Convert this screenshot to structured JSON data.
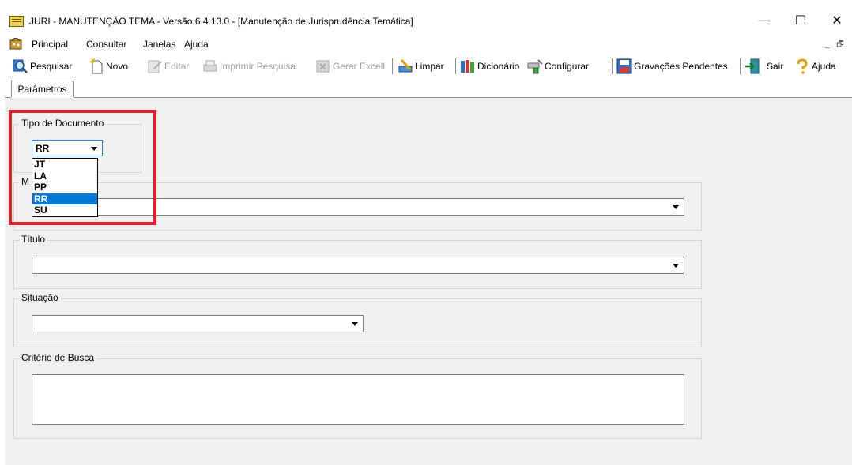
{
  "window": {
    "title": "JURI - MANUTENÇÃO TEMA - Versão 6.4.13.0 - [Manutenção de Jurisprudência Temática]",
    "minimize_glyph": "—",
    "maximize_glyph": "☐",
    "close_glyph": "✕"
  },
  "menu": {
    "items": [
      "Principal",
      "Consultar",
      "Janelas",
      "Ajuda"
    ],
    "mdi_min": "_",
    "mdi_restore": "🗗"
  },
  "toolbar": {
    "buttons": [
      {
        "label": "Pesquisar",
        "icon": "search-icon",
        "enabled": true
      },
      {
        "label": "Novo",
        "icon": "new-document-icon",
        "enabled": true
      },
      {
        "label": "Editar",
        "icon": "edit-icon",
        "enabled": false
      },
      {
        "label": "Imprimir Pesquisa",
        "icon": "printer-icon",
        "enabled": false
      },
      {
        "label": "Gerar Excell",
        "icon": "excel-icon",
        "enabled": false
      },
      {
        "label": "Limpar",
        "icon": "clear-icon",
        "enabled": true
      },
      {
        "label": "Dicionário",
        "icon": "books-icon",
        "enabled": true
      },
      {
        "label": "Configurar",
        "icon": "configure-icon",
        "enabled": true
      },
      {
        "label": "Gravações Pendentes",
        "icon": "save-pending-icon",
        "enabled": true
      },
      {
        "label": "Sair",
        "icon": "exit-icon",
        "enabled": true
      },
      {
        "label": "Ajuda",
        "icon": "help-icon",
        "enabled": true
      }
    ]
  },
  "tabs": [
    {
      "label": "Parâmetros",
      "active": true
    }
  ],
  "form": {
    "tipo_documento": {
      "label": "Tipo de Documento",
      "value": "RR",
      "options": [
        "JT",
        "LA",
        "PP",
        "RR",
        "SU"
      ],
      "selected_option": "RR"
    },
    "group2": {
      "label": "M",
      "value": ""
    },
    "titulo": {
      "label": "Título",
      "value": ""
    },
    "situacao": {
      "label": "Situação",
      "value": ""
    },
    "criterio": {
      "label": "Critério de Busca",
      "value": ""
    }
  },
  "colors": {
    "highlight": "#e0202b",
    "selection": "#0078d7",
    "panel": "#f0f0f0"
  }
}
